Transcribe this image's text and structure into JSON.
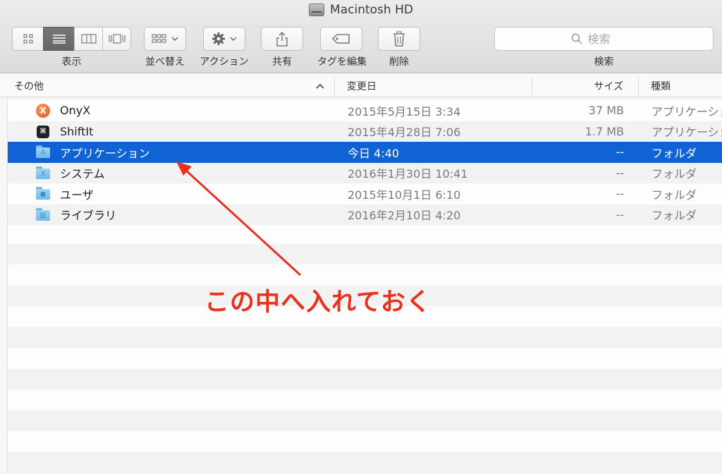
{
  "window": {
    "title": "Macintosh HD",
    "icon": "hard-disk-icon"
  },
  "toolbar": {
    "view_label": "表示",
    "sort_label": "並べ替え",
    "action_label": "アクション",
    "share_label": "共有",
    "tag_label": "タグを編集",
    "delete_label": "削除",
    "search_label": "検索",
    "search_placeholder": "検索"
  },
  "columns": {
    "name": "その他",
    "date": "変更日",
    "size": "サイズ",
    "kind": "種類"
  },
  "files": [
    {
      "name": "OnyX",
      "date": "2015年5月15日 3:34",
      "size": "37 MB",
      "kind": "アプリケーション",
      "icon": "onyx-app-icon"
    },
    {
      "name": "ShiftIt",
      "date": "2015年4月28日 7:06",
      "size": "1.7 MB",
      "kind": "アプリケーション",
      "icon": "shiftit-app-icon"
    },
    {
      "name": "アプリケーション",
      "date": "今日 4:40",
      "size": "--",
      "kind": "フォルダ",
      "icon": "applications-folder-icon",
      "selected": true
    },
    {
      "name": "システム",
      "date": "2016年1月30日 10:41",
      "size": "--",
      "kind": "フォルダ",
      "icon": "system-folder-icon"
    },
    {
      "name": "ユーザ",
      "date": "2015年10月1日 6:10",
      "size": "--",
      "kind": "フォルダ",
      "icon": "users-folder-icon"
    },
    {
      "name": "ライブラリ",
      "date": "2016年2月10日 4:20",
      "size": "--",
      "kind": "フォルダ",
      "icon": "library-folder-icon"
    }
  ],
  "annotation": {
    "text": "この中へ入れておく",
    "color": "#e8321e"
  },
  "colors": {
    "selection": "#1063d4"
  }
}
